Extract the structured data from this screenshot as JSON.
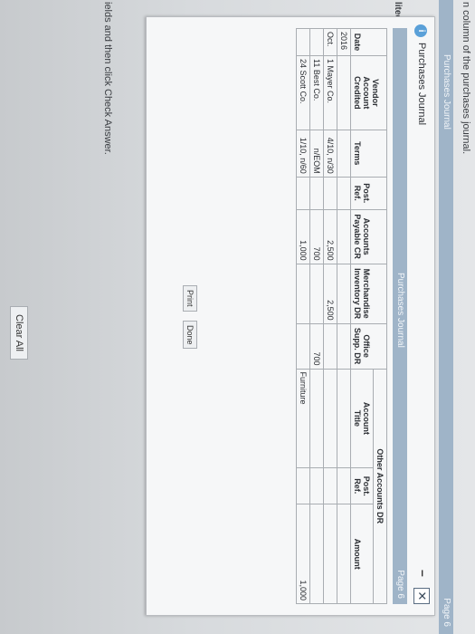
{
  "background": {
    "instruction_top": "n column of the purchases journal.",
    "bar_title": "Purchases Journal",
    "bar_page": "Page 6",
    "side_label": "lited",
    "instruction_bottom": "ields and then click Check Answer.",
    "clear_all": "Clear All"
  },
  "modal": {
    "title": "Purchases Journal",
    "info": "i",
    "minimize": "–",
    "close": "✕",
    "inner_bar": "Purchases Journal",
    "inner_page": "Page 6",
    "print": "Print",
    "done": "Done"
  },
  "journal": {
    "headers": {
      "date": "Date",
      "vendor_line1": "Vendor",
      "vendor_line2": "Account Credited",
      "terms": "Terms",
      "post_ref_1": "Post.",
      "post_ref_2": "Ref.",
      "ap_1": "Accounts",
      "ap_2": "Payable CR",
      "merch_1": "Merchandise",
      "merch_2": "Inventory DR",
      "office_1": "Office",
      "office_2": "Supp. DR",
      "other_group": "Other Accounts DR",
      "acct_title_1": "Account",
      "acct_title_2": "Title",
      "other_post_1": "Post.",
      "other_post_2": "Ref.",
      "amount": "Amount"
    },
    "year": "2016",
    "rows": [
      {
        "month": "Oct.",
        "day": "1",
        "vendor": "Mayer Co.",
        "terms": "4/10, n/30",
        "ap": "2,500",
        "merch": "2,500",
        "office": "",
        "title": "",
        "post": "",
        "amount": ""
      },
      {
        "month": "",
        "day": "11",
        "vendor": "Best Co.",
        "terms": "n/EOM",
        "ap": "700",
        "merch": "",
        "office": "700",
        "title": "",
        "post": "",
        "amount": ""
      },
      {
        "month": "",
        "day": "24",
        "vendor": "Scott Co.",
        "terms": "1/10, n/60",
        "ap": "1,000",
        "merch": "",
        "office": "",
        "title": "Furniture",
        "post": "",
        "amount": "1,000"
      }
    ]
  }
}
